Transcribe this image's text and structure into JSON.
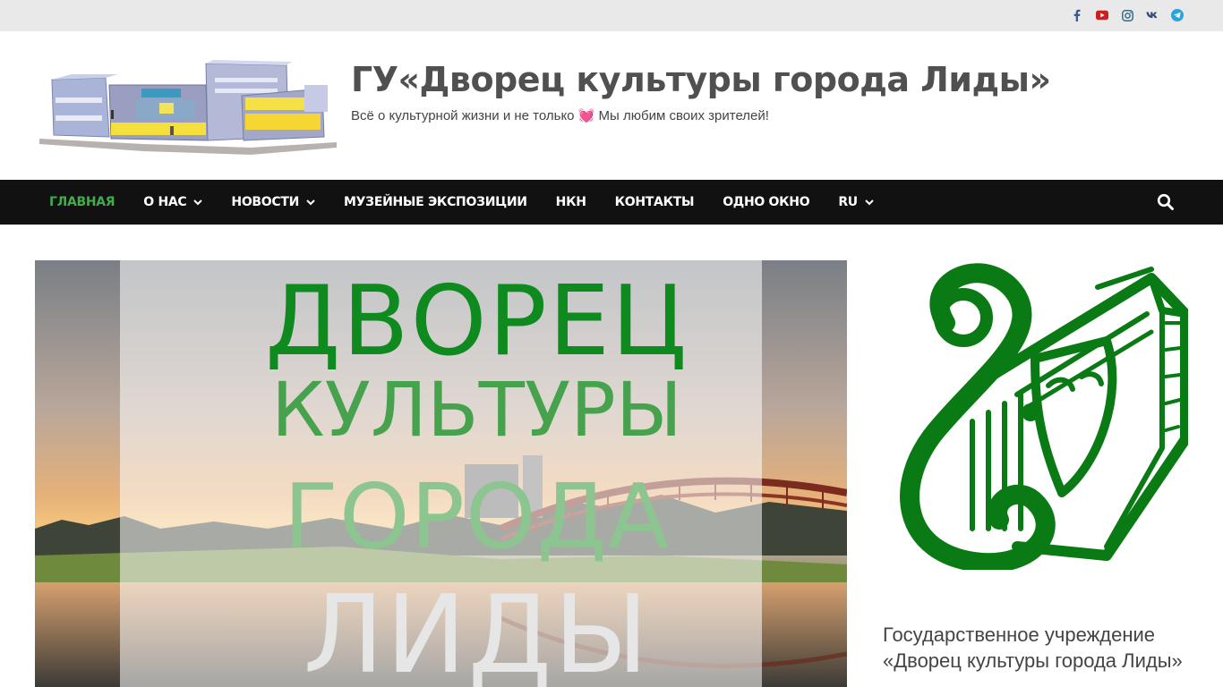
{
  "topbar": {
    "social": [
      {
        "name": "facebook",
        "glyph": "f",
        "color": "#3b5998"
      },
      {
        "name": "youtube",
        "glyph": "▶",
        "color": "#cc2020"
      },
      {
        "name": "instagram",
        "glyph": "◎",
        "color": "#2f6f8a"
      },
      {
        "name": "vk",
        "glyph": "vk",
        "color": "#2f4f7f"
      },
      {
        "name": "telegram",
        "glyph": "➤",
        "color": "#2aa3df"
      }
    ]
  },
  "header": {
    "title": "ГУ«Дворец культуры города Лиды»",
    "tagline_before": "Всё о культурной жизни и не только ",
    "tagline_heart": "💓",
    "tagline_after": " Мы любим своих зрителей!"
  },
  "nav": {
    "items": [
      {
        "label": "ГЛАВНАЯ",
        "active": true,
        "dropdown": false
      },
      {
        "label": "О НАС",
        "active": false,
        "dropdown": true
      },
      {
        "label": "НОВОСТИ",
        "active": false,
        "dropdown": true
      },
      {
        "label": "МУЗЕЙНЫЕ ЭКСПОЗИЦИИ",
        "active": false,
        "dropdown": false
      },
      {
        "label": "НКН",
        "active": false,
        "dropdown": false
      },
      {
        "label": "КОНТАКТЫ",
        "active": false,
        "dropdown": false
      },
      {
        "label": "ОДНО ОКНО",
        "active": false,
        "dropdown": false
      },
      {
        "label": "RU",
        "active": false,
        "dropdown": true
      }
    ]
  },
  "hero": {
    "line1": "ДВОРЕЦ",
    "line2": "КУЛЬТУРЫ",
    "line3": "ГОРОДА",
    "line4": "ЛИДЫ"
  },
  "sidebar": {
    "caption_line1": "Государственное учреждение",
    "caption_line2": "«Дворец культуры города Лиды»"
  },
  "colors": {
    "accent": "#3fae49",
    "nav_bg": "#111111",
    "topbar_bg": "#e9e9e9",
    "logo_green": "#0a7a14"
  }
}
